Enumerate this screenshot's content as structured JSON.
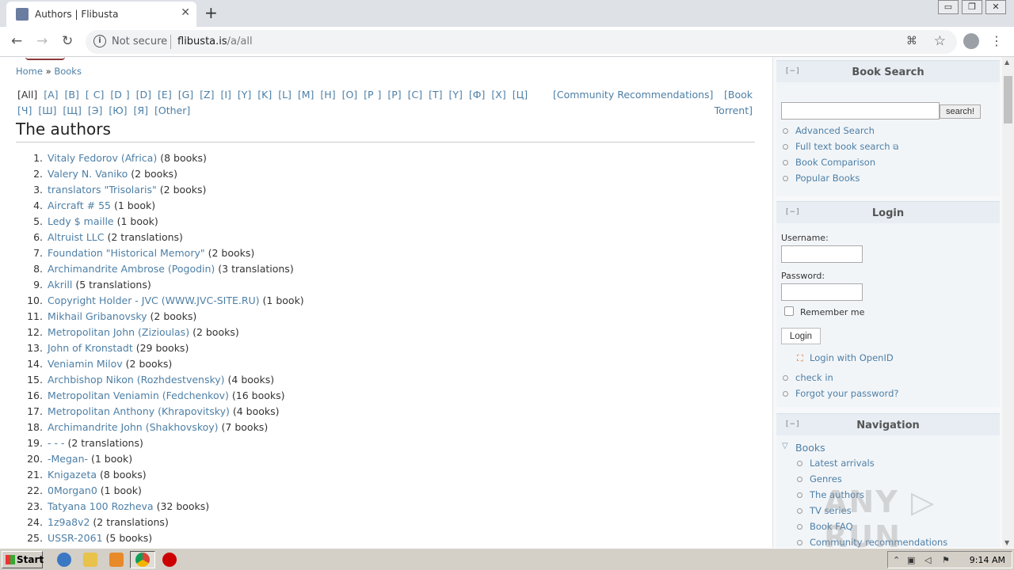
{
  "browser": {
    "tab_title": "Authors | Flibusta",
    "tab_close": "✕",
    "new_tab": "+",
    "security_label": "Not secure",
    "url_host": "flibusta.is",
    "url_path": "/a/all",
    "window_controls": [
      "▭",
      "❐",
      "✕"
    ]
  },
  "breadcrumb": {
    "home": "Home",
    "sep": "»",
    "books": "Books"
  },
  "letters": [
    "[All]",
    "[A]",
    "[B]",
    "[ C]",
    "[D ]",
    "[D]",
    "[E]",
    "[G]",
    "[Z]",
    "[I]",
    "[Y]",
    "[K]",
    "[L]",
    "[M]",
    "[H]",
    "[O]",
    "[P ]",
    "[P]",
    "[C]",
    "[T]",
    "[Y]",
    "[Ф]",
    "[X]",
    "[Ц]",
    "[Ч]",
    "[Ш]",
    "[Щ]",
    "[Э]",
    "[Ю]",
    "[Я]",
    "[Other]"
  ],
  "extra_links": {
    "community": "[Community Recommendations]",
    "torrent_1": "[Book",
    "torrent_2": "Torrent]"
  },
  "page_title": "The authors",
  "authors": [
    {
      "num": "1.",
      "name": "Vitaly Fedorov (Africa)",
      "count": "(8 books)"
    },
    {
      "num": "2.",
      "name": "Valery N. Vaniko",
      "count": "(2 books)"
    },
    {
      "num": "3.",
      "name": "translators \"Trisolaris\"",
      "count": "(2 books)"
    },
    {
      "num": "4.",
      "name": "Aircraft # 55",
      "count": "(1 book)"
    },
    {
      "num": "5.",
      "name": "Ledy $ maille",
      "count": "(1 book)"
    },
    {
      "num": "6.",
      "name": "Altruist LLC",
      "count": "(2 translations)"
    },
    {
      "num": "7.",
      "name": "Foundation \"Historical Memory\"",
      "count": "(2 books)"
    },
    {
      "num": "8.",
      "name": "Archimandrite Ambrose (Pogodin)",
      "count": "(3 translations)"
    },
    {
      "num": "9.",
      "name": "Akrill",
      "count": "(5 translations)"
    },
    {
      "num": "10.",
      "name": "Copyright Holder - JVC (WWW.JVC-SITE.RU)",
      "count": "(1 book)"
    },
    {
      "num": "11.",
      "name": "Mikhail Gribanovsky",
      "count": "(2 books)"
    },
    {
      "num": "12.",
      "name": "Metropolitan John (Zizioulas)",
      "count": "(2 books)"
    },
    {
      "num": "13.",
      "name": "John of Kronstadt",
      "count": "(29 books)"
    },
    {
      "num": "14.",
      "name": "Veniamin Milov",
      "count": "(2 books)"
    },
    {
      "num": "15.",
      "name": "Archbishop Nikon (Rozhdestvensky)",
      "count": "(4 books)"
    },
    {
      "num": "16.",
      "name": "Metropolitan Veniamin (Fedchenkov)",
      "count": "(16 books)"
    },
    {
      "num": "17.",
      "name": "Metropolitan Anthony (Khrapovitsky)",
      "count": "(4 books)"
    },
    {
      "num": "18.",
      "name": "Archimandrite John (Shakhovskoy)",
      "count": "(7 books)"
    },
    {
      "num": "19.",
      "name": "- - -",
      "count": "(2 translations)"
    },
    {
      "num": "20.",
      "name": "-Megan-",
      "count": "(1 book)"
    },
    {
      "num": "21.",
      "name": "Knigazeta",
      "count": "(8 books)"
    },
    {
      "num": "22.",
      "name": "0Morgan0",
      "count": "(1 book)"
    },
    {
      "num": "23.",
      "name": "Tatyana 100 Rozheva",
      "count": "(32 books)"
    },
    {
      "num": "24.",
      "name": "1z9a8v2",
      "count": "(2 translations)"
    },
    {
      "num": "25.",
      "name": "USSR-2061",
      "count": "(5 books)"
    }
  ],
  "sidebar": {
    "toggle": "[−]",
    "search": {
      "title": "Book Search",
      "button": "search!",
      "links": [
        "Advanced Search",
        "Full text book search",
        "Book Comparison",
        "Popular Books"
      ]
    },
    "login": {
      "title": "Login",
      "username_label": "Username:",
      "password_label": "Password:",
      "remember": "Remember me",
      "button": "Login",
      "openid": "Login with OpenID",
      "links": [
        "check in",
        "Forgot your password?"
      ]
    },
    "navigation": {
      "title": "Navigation",
      "root": "Books",
      "items": [
        "Latest arrivals",
        "Genres",
        "The authors",
        "TV series",
        "Book FAQ",
        "Community recommendations"
      ]
    }
  },
  "watermark": "ANY ▷ RUN",
  "taskbar": {
    "start": "Start",
    "clock": "9:14 AM"
  },
  "colors": {
    "link": "#4d7fa6",
    "sidebar_head": "#e7edf3",
    "taskbar": "#d4d0c8"
  }
}
